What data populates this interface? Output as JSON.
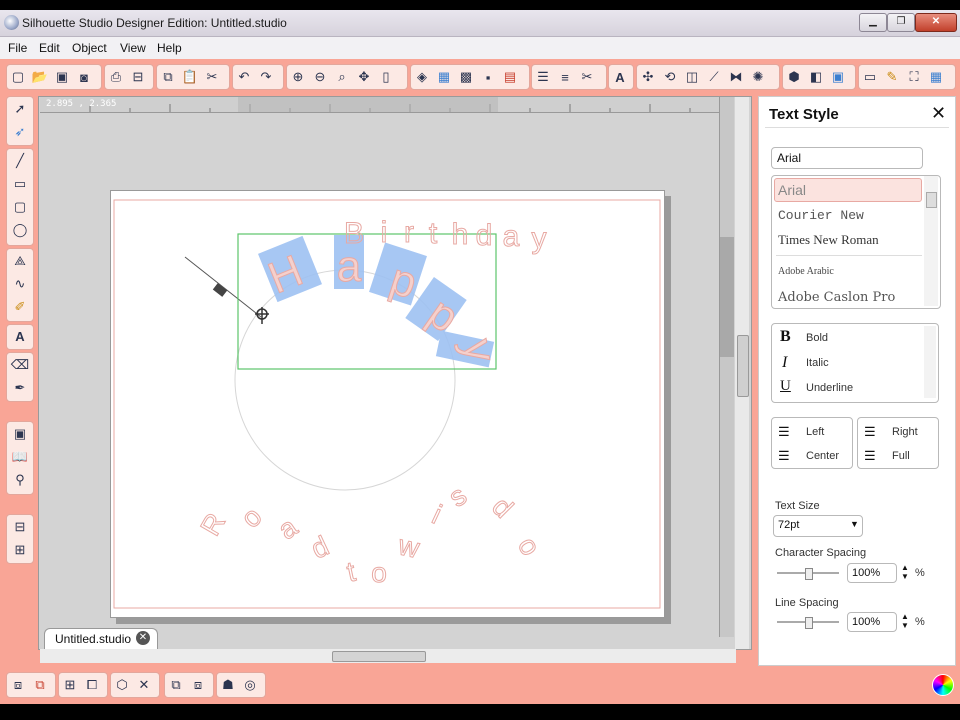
{
  "window": {
    "title": "Silhouette Studio Designer Edition: Untitled.studio",
    "min": "▁",
    "max": "❐",
    "close": "✕"
  },
  "menu": [
    "File",
    "Edit",
    "Object",
    "View",
    "Help"
  ],
  "toolbar_icons": [
    "new-icon",
    "open-icon",
    "save-icon",
    "save-as-icon",
    "print-icon",
    "cut-send-icon",
    "copy-icon",
    "paste-icon",
    "cut-icon",
    "undo-icon",
    "redo-icon",
    "zoom-in-icon",
    "zoom-out-icon",
    "zoom-select-icon",
    "pan-icon",
    "fit-page-icon",
    "fill-color-icon",
    "fill-gradient-icon",
    "fill-pattern-icon",
    "line-color-icon",
    "line-style-icon",
    "cut-style-icon",
    "text-style-icon",
    "align-icon",
    "transform-icon",
    "replicate-icon",
    "offset-icon",
    "modify-icon",
    "trace-icon",
    "page-setup-icon",
    "registration-icon",
    "cut-settings-icon",
    "design-page-icon",
    "sketch-icon",
    "cut-icon2",
    "grid-icon"
  ],
  "ruler": {
    "coordinate": "2.895 , 2.365"
  },
  "canvas": {
    "arc_top_text": "Birthday",
    "selected_text": "Happy",
    "arc_bottom_text": "Road to wisdom"
  },
  "tab": {
    "label": "Untitled.studio"
  },
  "panel": {
    "title": "Text Style",
    "font_input": "Arial",
    "fonts": [
      "Arial",
      "Courier New",
      "Times New Roman",
      "Adobe Arabic",
      "Adobe Caslon Pro"
    ],
    "styles": [
      {
        "glyph": "B",
        "label": "Bold"
      },
      {
        "glyph": "I",
        "label": "Italic"
      },
      {
        "glyph": "U",
        "label": "Underline"
      }
    ],
    "align": {
      "left": "Left",
      "center": "Center",
      "right": "Right",
      "full": "Full"
    },
    "text_size_label": "Text Size",
    "text_size": "72pt",
    "char_spacing_label": "Character Spacing",
    "char_spacing": "100%",
    "line_spacing_label": "Line Spacing",
    "line_spacing": "100%",
    "pct": "%"
  },
  "colors": {
    "accent": "#f9a596",
    "selection_fill": "#9ec1f2",
    "selection_box": "#5cc46a",
    "outline_text": "#e8a9a3"
  }
}
